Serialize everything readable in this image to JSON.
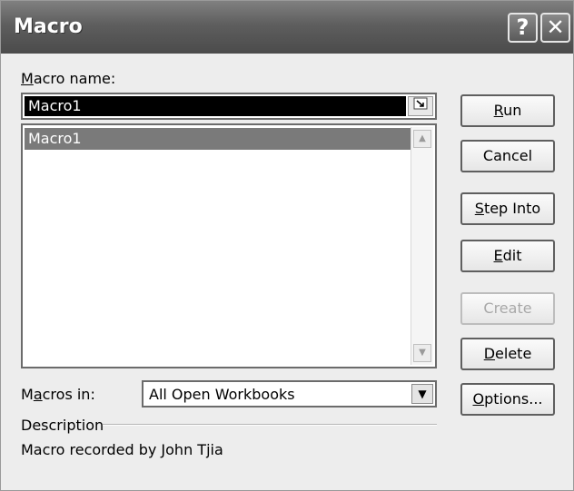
{
  "window": {
    "title": "Macro",
    "help_glyph": "?",
    "close_glyph": "✕"
  },
  "macro_name": {
    "label_u": "M",
    "label_rest": "acro name:",
    "value": "Macro1"
  },
  "macro_list": {
    "items": [
      "Macro1"
    ],
    "selected": "Macro1"
  },
  "macros_in": {
    "label_pre": "M",
    "label_u": "a",
    "label_rest": "cros in:",
    "value": "All Open Workbooks"
  },
  "description": {
    "label": "Description",
    "text": "Macro recorded by John Tjia"
  },
  "buttons": {
    "run": {
      "u": "R",
      "rest": "un"
    },
    "cancel": {
      "label": "Cancel"
    },
    "step_into": {
      "u": "S",
      "rest": "tep Into"
    },
    "edit": {
      "u": "E",
      "rest": "dit"
    },
    "create": {
      "label": "Create",
      "enabled": false
    },
    "delete": {
      "u": "D",
      "rest": "elete"
    },
    "options": {
      "u": "O",
      "rest": "ptions..."
    }
  },
  "icons": [
    "help-icon",
    "close-icon",
    "collapse-dialog-icon",
    "scroll-up-icon",
    "scroll-down-icon",
    "chevron-down-icon"
  ]
}
